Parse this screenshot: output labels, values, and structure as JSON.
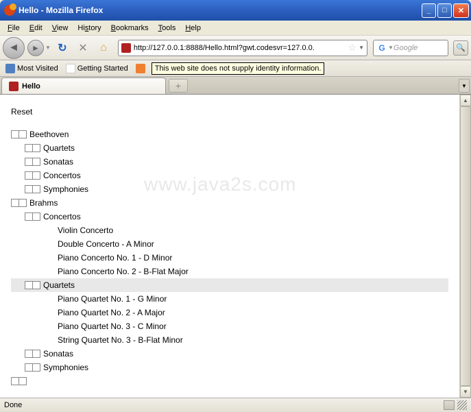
{
  "titlebar": {
    "text": "Hello - Mozilla Firefox"
  },
  "menu": {
    "file": "File",
    "edit": "Edit",
    "view": "View",
    "history": "History",
    "bookmarks": "Bookmarks",
    "tools": "Tools",
    "help": "Help"
  },
  "toolbar": {
    "url": "http://127.0.0.1:8888/Hello.html?gwt.codesvr=127.0.0.",
    "search_placeholder": "Google"
  },
  "bookmarks_bar": {
    "most_visited": "Most Visited",
    "getting_started": "Getting Started",
    "tooltip": "This web site does not supply identity information."
  },
  "tab": {
    "title": "Hello"
  },
  "content": {
    "reset": "Reset",
    "watermark": "www.java2s.com",
    "tree": [
      {
        "level": 0,
        "boxes": 2,
        "label": "Beethoven"
      },
      {
        "level": 1,
        "boxes": 2,
        "label": "Quartets"
      },
      {
        "level": 1,
        "boxes": 2,
        "label": "Sonatas"
      },
      {
        "level": 1,
        "boxes": 2,
        "label": "Concertos"
      },
      {
        "level": 1,
        "boxes": 2,
        "label": "Symphonies"
      },
      {
        "level": 0,
        "boxes": 2,
        "label": "Brahms"
      },
      {
        "level": 1,
        "boxes": 2,
        "label": "Concertos"
      },
      {
        "level": 2,
        "boxes": 0,
        "label": "Violin Concerto"
      },
      {
        "level": 2,
        "boxes": 0,
        "label": "Double Concerto - A Minor"
      },
      {
        "level": 2,
        "boxes": 0,
        "label": "Piano Concerto No. 1 - D Minor"
      },
      {
        "level": 2,
        "boxes": 0,
        "label": "Piano Concerto No. 2 - B-Flat Major"
      },
      {
        "level": 1,
        "boxes": 2,
        "label": "Quartets",
        "hl": true
      },
      {
        "level": 2,
        "boxes": 0,
        "label": "Piano Quartet No. 1 - G Minor"
      },
      {
        "level": 2,
        "boxes": 0,
        "label": "Piano Quartet No. 2 - A Major"
      },
      {
        "level": 2,
        "boxes": 0,
        "label": "Piano Quartet No. 3 - C Minor"
      },
      {
        "level": 2,
        "boxes": 0,
        "label": "String Quartet No. 3 - B-Flat Minor"
      },
      {
        "level": 1,
        "boxes": 2,
        "label": "Sonatas"
      },
      {
        "level": 1,
        "boxes": 2,
        "label": "Symphonies"
      },
      {
        "level": 0,
        "boxes": 2,
        "label": ""
      }
    ]
  },
  "statusbar": {
    "text": "Done"
  }
}
